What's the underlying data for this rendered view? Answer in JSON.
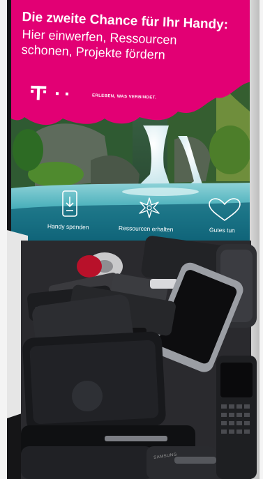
{
  "banner": {
    "headline": "Die zweite Chance für Ihr Handy:",
    "subline": [
      "Hier einwerfen, Ressourcen",
      "schonen, Projekte fördern"
    ],
    "logo_text": "T",
    "tagline": "ERLEBEN, WAS VERBINDET.",
    "features": [
      {
        "label": "Handy spenden",
        "icon": "phone-donate-icon"
      },
      {
        "label": "Ressourcen erhalten",
        "icon": "sparkle-flower-icon"
      },
      {
        "label": "Gutes tun",
        "icon": "heart-icon"
      }
    ],
    "brand_color": "#e20074"
  },
  "phone_brand": "SAMSUNG"
}
